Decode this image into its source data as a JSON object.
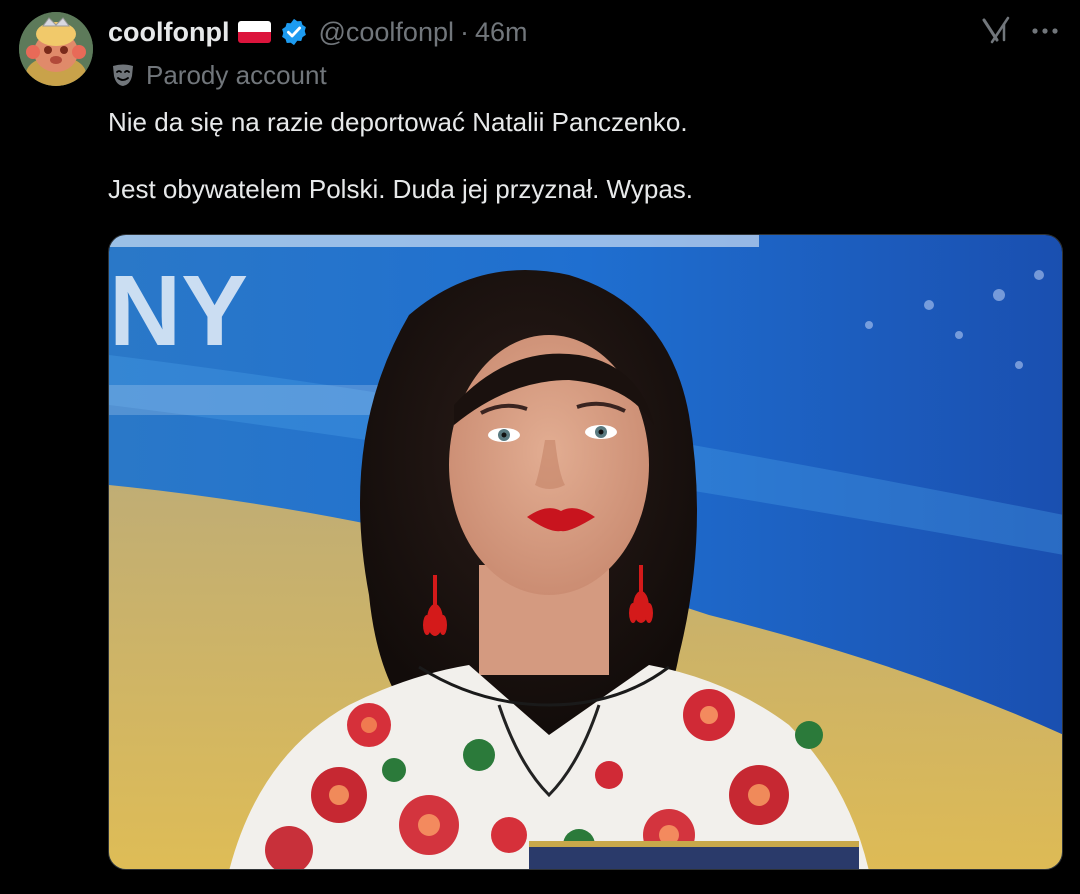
{
  "author": {
    "display_name": "coolfonpl",
    "handle": "@coolfonpl",
    "separator": "·",
    "time_ago": "46m",
    "flag_icon": "poland-flag-icon",
    "verified_icon": "verified-badge-icon",
    "avatar_icon": "troll-doll-avatar"
  },
  "label": {
    "icon": "theater-mask-icon",
    "text": "Parody account"
  },
  "actions": {
    "grok_icon": "grok-icon",
    "more_icon": "more-options-icon"
  },
  "tweet": {
    "paragraphs": [
      "Nie da się na razie deportować Natalii Panczenko.",
      "Jest obywatelem Polski. Duda jej przyznał. Wypas."
    ]
  },
  "media": {
    "type": "photo",
    "banner_text": "NY"
  },
  "colors": {
    "background": "#000000",
    "text_primary": "#e7e9ea",
    "text_secondary": "#71767b",
    "verified_blue": "#1d9bf0"
  }
}
